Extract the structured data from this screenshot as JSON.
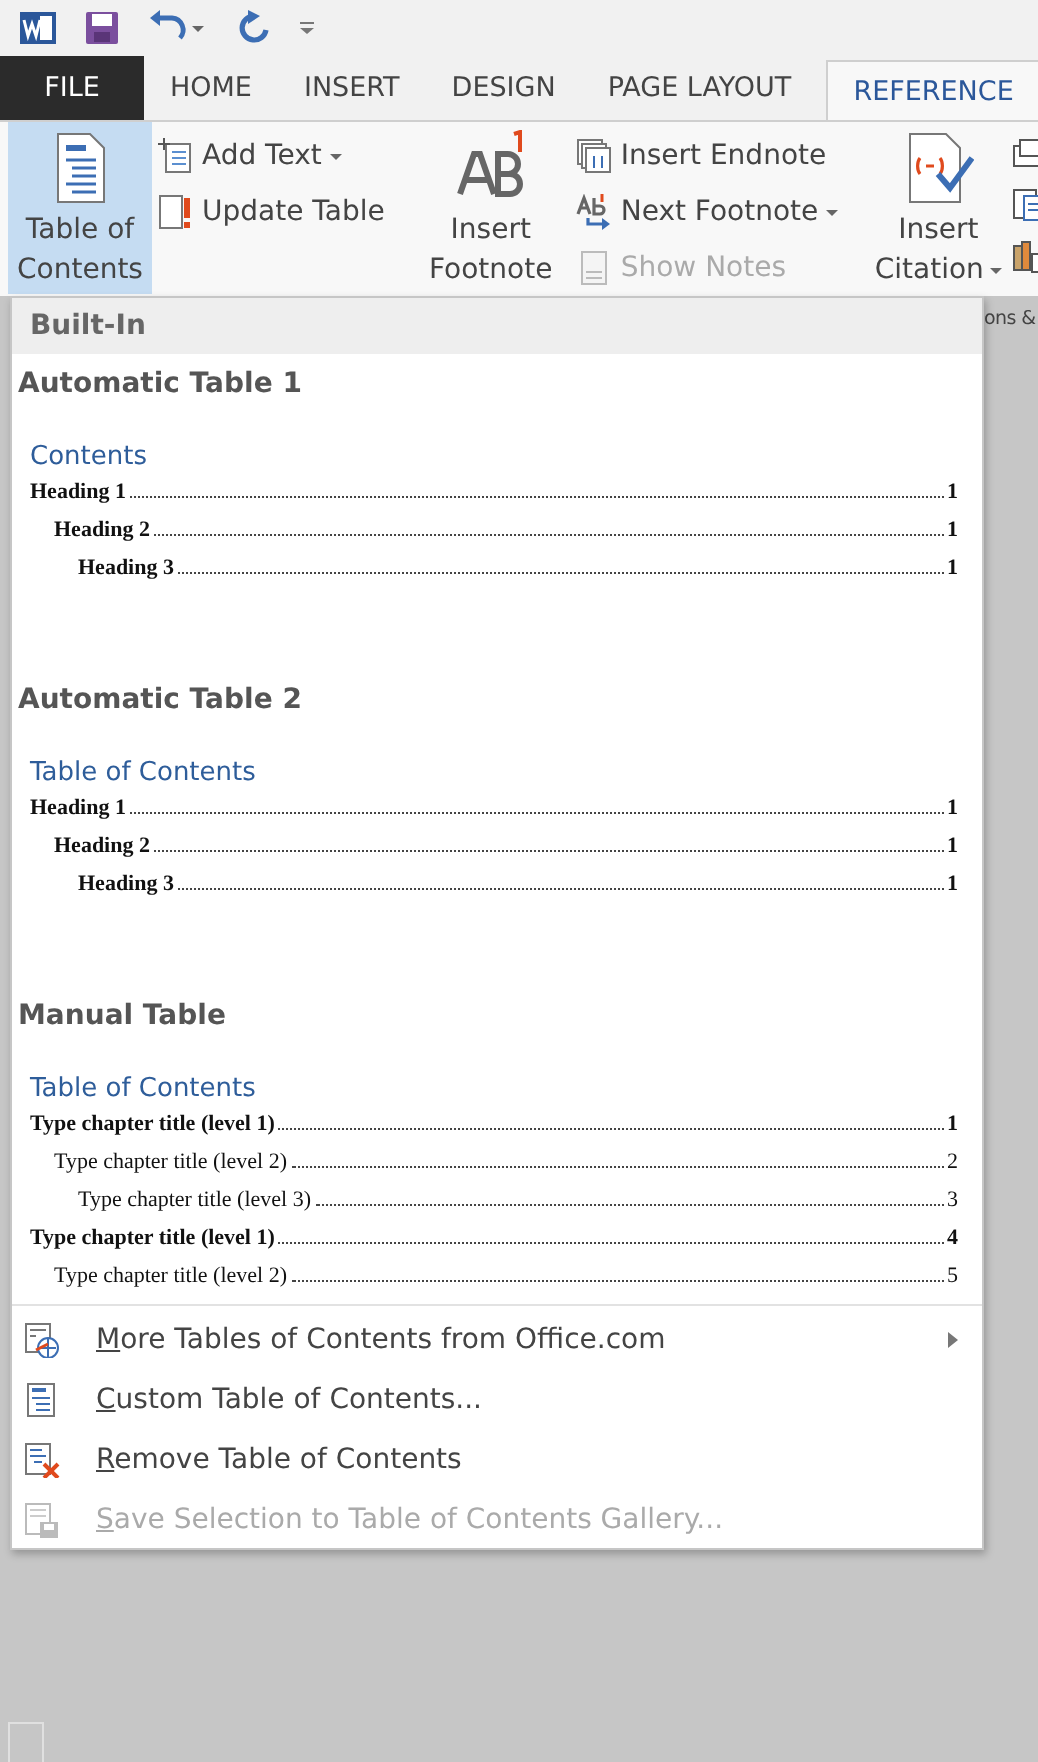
{
  "tabs": [
    {
      "label": "FILE",
      "kind": "file",
      "selected": false
    },
    {
      "label": "HOME",
      "kind": "tab",
      "selected": false
    },
    {
      "label": "INSERT",
      "kind": "tab",
      "selected": false
    },
    {
      "label": "DESIGN",
      "kind": "tab",
      "selected": false
    },
    {
      "label": "PAGE LAYOUT",
      "kind": "tab",
      "selected": false
    },
    {
      "label": "REFERENCE",
      "kind": "tab",
      "selected": true
    }
  ],
  "ribbon": {
    "toc_button": {
      "label": "Table of Contents",
      "selected": true
    },
    "toc_commands": [
      {
        "label": "Add Text",
        "kind": "add-text",
        "dropdown": true,
        "disabled": false
      },
      {
        "label": "Update Table",
        "kind": "update",
        "dropdown": false,
        "disabled": false
      }
    ],
    "footnote_button": {
      "label": "Insert Footnote"
    },
    "footnote_commands": [
      {
        "label": "Insert Endnote",
        "kind": "endnote",
        "dropdown": false,
        "disabled": false
      },
      {
        "label": "Next Footnote",
        "kind": "next",
        "dropdown": true,
        "disabled": false
      },
      {
        "label": "Show Notes",
        "kind": "notes",
        "dropdown": false,
        "disabled": true
      }
    ],
    "citation_button": {
      "label": "Insert Citation"
    },
    "group_label": "ons &"
  },
  "menu": {
    "header": "Built-In",
    "gallery": [
      {
        "title": "Automatic Table 1",
        "heading": "Contents",
        "entries": [
          {
            "text": "Heading 1",
            "page": "1",
            "bold": true,
            "children": [
              {
                "text": "Heading 2",
                "page": "1",
                "bold": true,
                "children": [
                  {
                    "text": "Heading 3",
                    "page": "1",
                    "bold": true
                  }
                ]
              }
            ]
          }
        ]
      },
      {
        "title": "Automatic Table 2",
        "heading": "Table of Contents",
        "entries": [
          {
            "text": "Heading 1",
            "page": "1",
            "bold": true,
            "children": [
              {
                "text": "Heading 2",
                "page": "1",
                "bold": true,
                "children": [
                  {
                    "text": "Heading 3",
                    "page": "1",
                    "bold": true
                  }
                ]
              }
            ]
          }
        ]
      },
      {
        "title": "Manual Table",
        "heading": "Table of Contents",
        "entries": [
          {
            "text": "Type chapter title (level 1)",
            "page": "1",
            "bold": true,
            "children": [
              {
                "text": "Type chapter title (level 2)",
                "page": "2",
                "bold": false,
                "children": [
                  {
                    "text": "Type chapter title (level 3)",
                    "page": "3",
                    "bold": false
                  }
                ]
              }
            ]
          },
          {
            "text": "Type chapter title (level 1)",
            "page": "4",
            "bold": true,
            "children": [
              {
                "text": "Type chapter title (level 2)",
                "page": "5",
                "bold": false
              }
            ]
          }
        ]
      }
    ],
    "items": [
      {
        "label": "More Tables of Contents from Office.com",
        "kind": "more",
        "submenu": true,
        "disabled": false
      },
      {
        "label": "Custom Table of Contents...",
        "kind": "custom",
        "submenu": false,
        "disabled": false
      },
      {
        "label": "Remove Table of Contents",
        "kind": "remove",
        "submenu": false,
        "disabled": false
      },
      {
        "label": "Save Selection to Table of Contents Gallery...",
        "kind": "save",
        "submenu": false,
        "disabled": true
      }
    ]
  }
}
